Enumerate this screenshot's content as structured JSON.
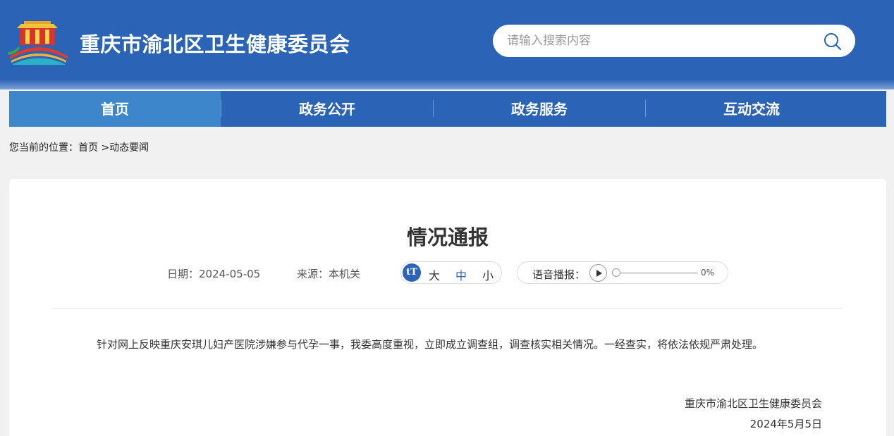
{
  "header": {
    "site_title": "重庆市渝北区卫生健康委员会",
    "search_placeholder": "请输入搜索内容"
  },
  "nav": {
    "items": [
      {
        "label": "首页",
        "active": true
      },
      {
        "label": "政务公开"
      },
      {
        "label": "政务服务"
      },
      {
        "label": "互动交流"
      }
    ]
  },
  "breadcrumb": {
    "prefix": "您当前的位置：",
    "home": "首页",
    "separator": " >",
    "current": "动态要闻"
  },
  "article": {
    "title": "情况通报",
    "date_label": "日期：",
    "date": "2024-05-05",
    "source_label": "来源：",
    "source": "本机关",
    "font_size": {
      "icon": "tT",
      "large": "大",
      "medium": "中",
      "small": "小",
      "selected": "中"
    },
    "audio": {
      "label": "语音播报：",
      "progress_text": "0%",
      "progress": 0
    },
    "body": "针对网上反映重庆安琪儿妇产医院涉嫌参与代孕一事，我委高度重视，立即成立调查组，调查核实相关情况。一经查实，将依法依规严肃处理。",
    "signature_org": "重庆市渝北区卫生健康委员会",
    "signature_date": "2024年5月5日"
  },
  "colors": {
    "brand_blue": "#2b63b6",
    "nav_active": "#3d86cc",
    "page_bg": "#f1f1f1"
  },
  "icons": {
    "logo": "tiananmen-emblem-logo",
    "search": "search-icon",
    "play": "play-icon",
    "font_size": "text-size-icon"
  }
}
